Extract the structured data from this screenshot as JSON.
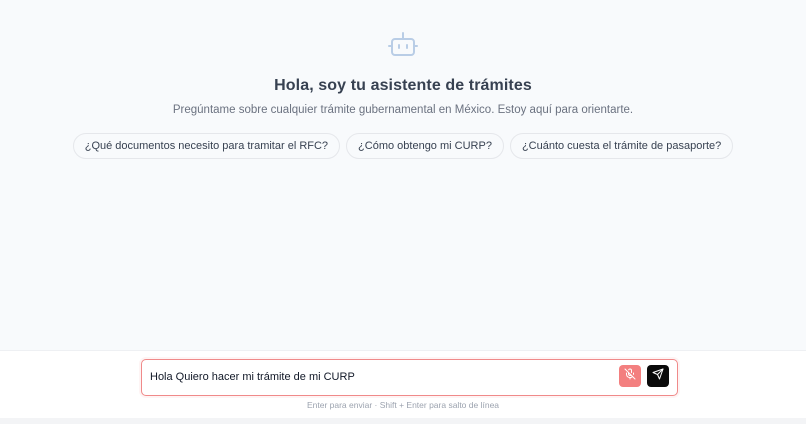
{
  "hero": {
    "icon": "bot-icon",
    "title": "Hola, soy tu asistente de trámites",
    "subtitle": "Pregúntame sobre cualquier trámite gubernamental en México. Estoy aquí para orientarte.",
    "suggestions": [
      "¿Qué documentos necesito para tramitar el RFC?",
      "¿Cómo obtengo mi CURP?",
      "¿Cuánto cuesta el trámite de pasaporte?"
    ]
  },
  "composer": {
    "value": "Hola Quiero hacer mi trámite de mi CURP",
    "mic_icon": "mic-off-icon",
    "send_icon": "send-icon",
    "hint": "Enter para enviar · Shift + Enter para salto de línea"
  },
  "colors": {
    "accent_red": "#f37f7f",
    "input_border": "#f08a8a",
    "icon_blue": "#b9cde6",
    "send_bg": "#0a0a0a"
  }
}
